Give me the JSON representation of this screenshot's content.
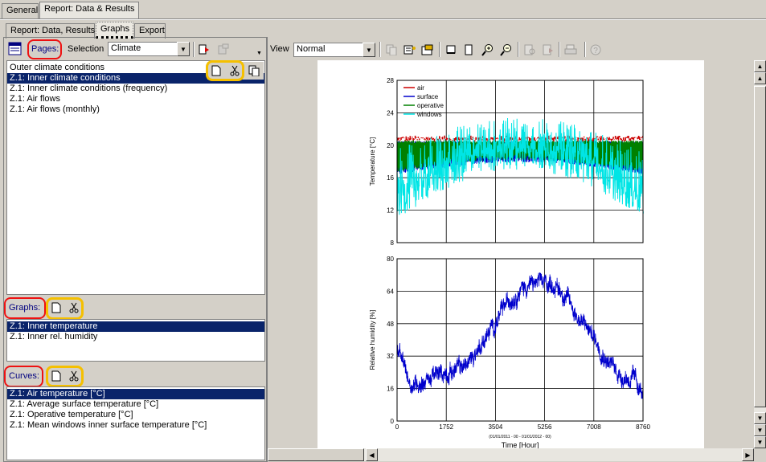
{
  "top_tabs": [
    {
      "label": "General",
      "active": false
    },
    {
      "label": "Report: Data & Results",
      "active": true
    }
  ],
  "sub_tabs": [
    {
      "label": "Report: Data, Results",
      "active": false
    },
    {
      "label": "Graphs",
      "active": true
    },
    {
      "label": "Export",
      "active": false
    }
  ],
  "pages": {
    "label": "Pages:",
    "selection_label": "Selection",
    "selection_value": "Climate",
    "items": [
      {
        "label": "Outer climate conditions",
        "selected": false
      },
      {
        "label": "Z.1: Inner climate conditions",
        "selected": true
      },
      {
        "label": "Z.1: Inner climate conditions (frequency)",
        "selected": false
      },
      {
        "label": "Z.1: Air flows",
        "selected": false
      },
      {
        "label": "Z.1: Air flows (monthly)",
        "selected": false
      }
    ]
  },
  "graphs": {
    "label": "Graphs:",
    "items": [
      {
        "label": "Z.1: Inner temperature",
        "selected": true
      },
      {
        "label": "Z.1: Inner rel. humidity",
        "selected": false
      }
    ]
  },
  "curves": {
    "label": "Curves:",
    "items": [
      {
        "label": "Z.1: Air temperature [°C]",
        "selected": true
      },
      {
        "label": "Z.1: Average surface temperature [°C]",
        "selected": false
      },
      {
        "label": "Z.1: Operative temperature [°C]",
        "selected": false
      },
      {
        "label": "Z.1: Mean windows inner surface temperature [°C]",
        "selected": false
      }
    ]
  },
  "view": {
    "label": "View",
    "value": "Normal"
  },
  "colors": {
    "selection": "#0a246a",
    "highlight_red": "#ee1111",
    "highlight_yellow": "#f5c000"
  },
  "chart_data": [
    {
      "type": "line",
      "ylabel": "Temperature [°C]",
      "ylim": [
        8,
        28
      ],
      "yticks": [
        "28",
        "24",
        "20",
        "16",
        "12",
        "8"
      ],
      "xlim": [
        0,
        8760
      ],
      "grid": true,
      "legend_position": "top-left",
      "series": [
        {
          "name": "air",
          "color": "#cc0000",
          "summary": "about 20.5 to 21, daily setpoint band all year"
        },
        {
          "name": "surface",
          "color": "#0000cc",
          "summary": "about 16.5 to 20.5"
        },
        {
          "name": "operative",
          "color": "#008000",
          "summary": "about 16.5 to 20.5"
        },
        {
          "name": "windows",
          "color": "#00e5e5",
          "summary": "winter about 11 to 20, summer about 17 to 25"
        }
      ]
    },
    {
      "type": "line",
      "ylabel": "Relative humidity [%]",
      "ylim": [
        0,
        80
      ],
      "yticks": [
        "80",
        "64",
        "48",
        "32",
        "16",
        "0"
      ],
      "xlim": [
        0,
        8760
      ],
      "xticks": [
        "0",
        "1752",
        "3504",
        "5256",
        "7008",
        "8760"
      ],
      "xsub": "(01/01/2011 - 00 - 01/01/2012 - 00)",
      "xlabel": "Time   [Hour]",
      "grid": true,
      "series": [
        {
          "name": "rel. humidity",
          "color": "#0000cc",
          "x": [
            0,
            500,
            1000,
            1500,
            2000,
            2500,
            3000,
            3500,
            4000,
            4500,
            5000,
            5500,
            6000,
            6500,
            7000,
            7500,
            8000,
            8500,
            8760
          ],
          "y": [
            35,
            18,
            20,
            23,
            25,
            28,
            38,
            48,
            60,
            66,
            68,
            68,
            62,
            50,
            42,
            30,
            22,
            20,
            12
          ]
        }
      ]
    }
  ]
}
